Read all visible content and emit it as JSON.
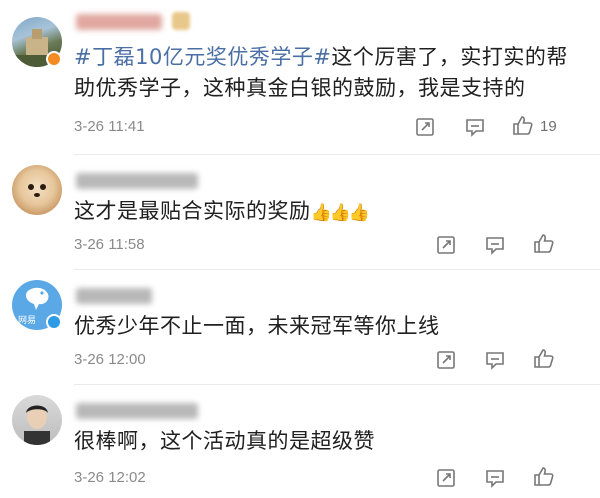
{
  "comments": [
    {
      "content_tag": "#丁磊10亿元奖优秀学子#",
      "content_text": "这个厉害了，实打实的帮助优秀学子，这种真金白银的鼓励，我是支持的",
      "time": "3-26 11:41",
      "like_count": "19"
    },
    {
      "content_text": "这才是最贴合实际的奖励",
      "emoji": "👍👍👍",
      "time": "3-26 11:58"
    },
    {
      "content_text": "优秀少年不止一面，未来冠军等你上线",
      "avatar_text": "网易",
      "time": "3-26 12:00"
    },
    {
      "content_text": "很棒啊，这个活动真的是超级赞",
      "time": "3-26 12:02"
    }
  ],
  "icons": {
    "share": "share-icon",
    "reply": "comment-icon",
    "like": "thumbs-up-icon"
  },
  "colors": {
    "tag": "#4a6fa5",
    "badge_orange": "#f28b24",
    "badge_blue": "#2d9be6",
    "text": "#202020",
    "meta": "#8a8a8a"
  }
}
